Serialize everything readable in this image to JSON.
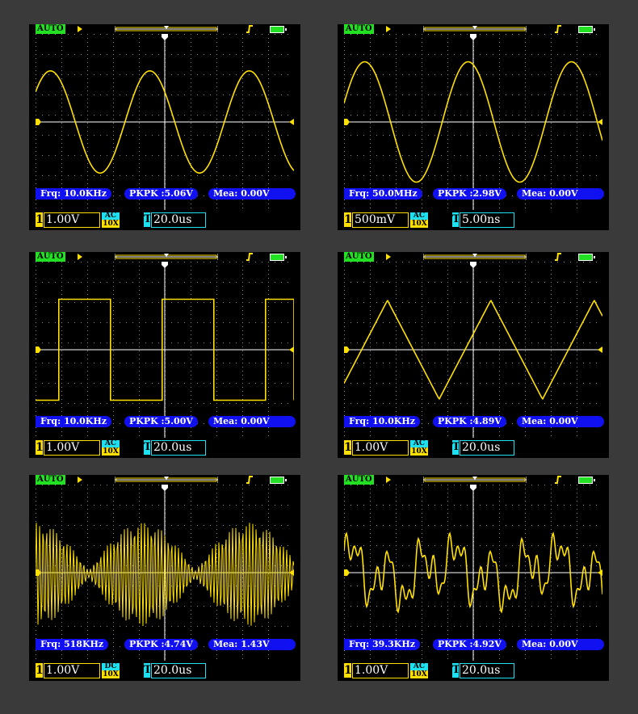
{
  "colors": {
    "trace": "#ffe000",
    "grid": "#ffffff",
    "measure_bg": "#1010f0",
    "ac_badge": "#1ee0f0",
    "auto_badge": "#22e022"
  },
  "icons": {
    "run": "play-icon",
    "trigger": "rising-edge-trigger-icon",
    "battery": "battery-icon"
  },
  "panels": [
    {
      "waveform": "sine",
      "wave_params": {
        "periods": 2.6,
        "amplitude_div": 2.53,
        "phase": 0.1,
        "offset_div": 0
      },
      "mode": "AUTO",
      "frequency": "Frq: 10.0KHz",
      "pkpk": "PKPK :5.06V",
      "mean": "Mea: 0.00V",
      "channel": "1",
      "volts_div": "1.00V",
      "coupling": "AC",
      "probe": "10X",
      "trigger_label": "T",
      "time_div": "20.0us"
    },
    {
      "waveform": "sine",
      "wave_params": {
        "periods": 2.5,
        "amplitude_div": 2.98,
        "phase": 0.05,
        "offset_div": 0
      },
      "mode": "AUTO",
      "frequency": "Frq: 50.0MHz",
      "pkpk": "PKPK :2.98V",
      "mean": "Mea: 0.00V",
      "channel": "1",
      "volts_div": "500mV",
      "coupling": "AC",
      "probe": "10X",
      "trigger_label": "T",
      "time_div": "5.00ns"
    },
    {
      "waveform": "square",
      "wave_params": {
        "periods": 2.5,
        "amplitude_div": 2.5,
        "phase": 0.0,
        "offset_div": 0
      },
      "mode": "AUTO",
      "frequency": "Frq: 10.0KHz",
      "pkpk": "PKPK :5.00V",
      "mean": "Mea: 0.00V",
      "channel": "1",
      "volts_div": "1.00V",
      "coupling": "AC",
      "probe": "10X",
      "trigger_label": "T",
      "time_div": "20.0us"
    },
    {
      "waveform": "triangle",
      "wave_params": {
        "periods": 2.5,
        "amplitude_div": 2.45,
        "phase": 0.08,
        "offset_div": 0
      },
      "mode": "AUTO",
      "frequency": "Frq: 10.0KHz",
      "pkpk": "PKPK :4.89V",
      "mean": "Mea: 0.00V",
      "channel": "1",
      "volts_div": "1.00V",
      "coupling": "AC",
      "probe": "10X",
      "trigger_label": "T",
      "time_div": "20.0us"
    },
    {
      "waveform": "am",
      "wave_params": {
        "periods": 2.5,
        "amplitude_div": 2.37,
        "phase": 0.0,
        "offset_div": 1.43
      },
      "mode": "AUTO",
      "frequency": "Frq: 518KHz",
      "pkpk": "PKPK :4.74V",
      "mean": "Mea: 1.43V",
      "channel": "1",
      "volts_div": "1.00V",
      "coupling": "DC",
      "probe": "10X",
      "trigger_label": "T",
      "time_div": "20.0us"
    },
    {
      "waveform": "complex",
      "wave_params": {
        "periods": 2.5,
        "amplitude_div": 2.46,
        "phase": 0.0,
        "offset_div": 0
      },
      "mode": "AUTO",
      "frequency": "Frq: 39.3KHz",
      "pkpk": "PKPK :4.92V",
      "mean": "Mea: 0.00V",
      "channel": "1",
      "volts_div": "1.00V",
      "coupling": "AC",
      "probe": "10X",
      "trigger_label": "T",
      "time_div": "20.0us"
    }
  ]
}
